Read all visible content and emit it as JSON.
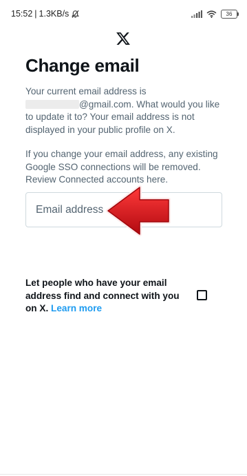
{
  "status_bar": {
    "time": "15:52",
    "separator": "|",
    "speed": "1.3KB/s",
    "battery": "36"
  },
  "page": {
    "title": "Change email",
    "description_prefix": "Your current email address is",
    "description_suffix": "@gmail.com. What would you like to update it to? Your email address is not displayed in your public profile on X.",
    "sso_note": "If you change your email address, any existing Google SSO connections will be removed. Review Connected accounts here.",
    "email_placeholder": "Email address",
    "email_value": "",
    "find_label": "Let people who have your email address find and connect with you on X.",
    "learn_more": "Learn more",
    "find_checked": false
  },
  "colors": {
    "accent": "#1d9bf0",
    "arrow": "#d9141b",
    "text_primary": "#0f1419",
    "text_secondary": "#536471"
  },
  "icons": [
    "x-logo-icon",
    "dnd-bell-off-icon",
    "signal-icon",
    "wifi-icon",
    "battery-icon",
    "red-arrow-annotation"
  ]
}
